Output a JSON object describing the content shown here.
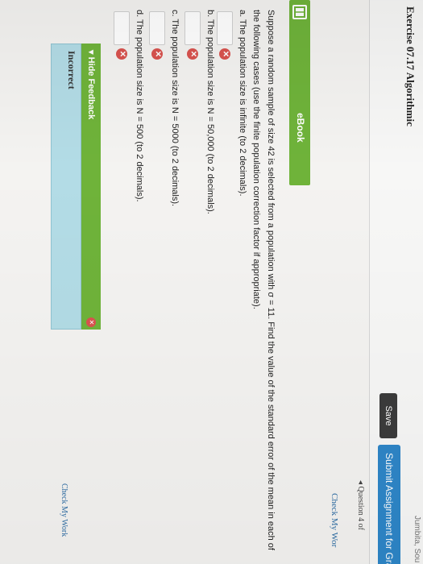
{
  "header": {
    "exercise_title": "Exercise 07.17 Algorithmic",
    "site_fragment": "Jumbita, Sou",
    "save_label": "Save",
    "submit_label": "Submit Assignment for Gra",
    "question_nav": "◂ Question 4 of",
    "check_my_work_top": "Check My Wor"
  },
  "ebook": {
    "label": "eBook",
    "icon": "book-icon"
  },
  "question": {
    "text": "Suppose a random sample of size 42 is selected from a population with σ = 11. Find the value of the standard error of the mean in each of the following cases (use the finite population correction factor if appropriate)."
  },
  "parts": [
    {
      "text": "a. The population size is infinite (to 2 decimals).",
      "value": "",
      "status": "incorrect"
    },
    {
      "text": "b. The population size is N = 50,000 (to 2 decimals).",
      "value": "",
      "status": "incorrect"
    },
    {
      "text": "c. The population size is N = 5000 (to 2 decimals).",
      "value": "",
      "status": "incorrect"
    },
    {
      "text": "d. The population size is N = 500 (to 2 decimals).",
      "value": "",
      "status": "incorrect"
    }
  ],
  "feedback": {
    "toggle_label": "▾ Hide Feedback",
    "result_label": "Incorrect"
  },
  "check_my_work_bottom": "Check My Work",
  "colors": {
    "green": "#6fb33a",
    "blue": "#2e86c8",
    "error": "#d9534f",
    "feedback_panel": "#b3dce6"
  }
}
